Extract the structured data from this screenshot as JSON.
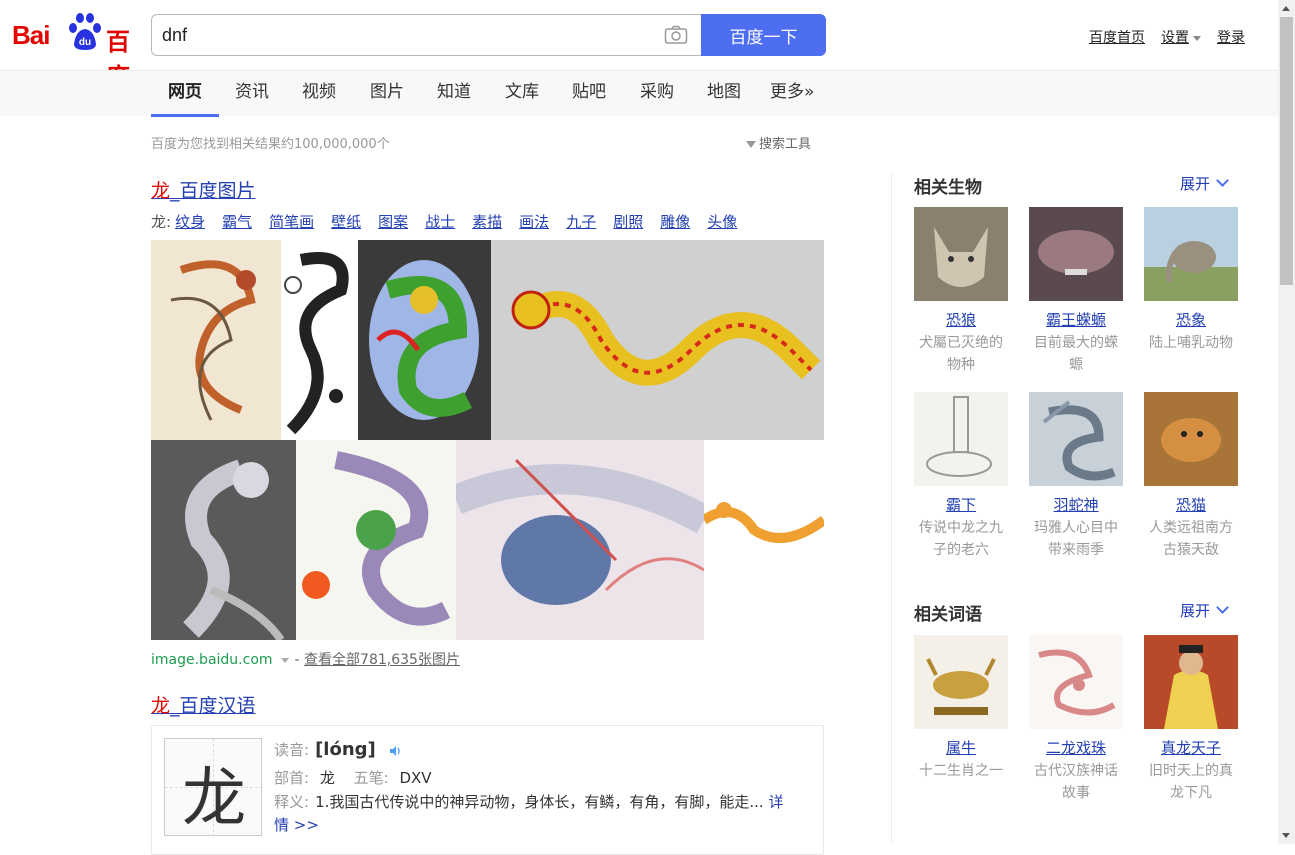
{
  "logo": {
    "bai": "Bai",
    "du": "du",
    "baidu_cn": "百度"
  },
  "search": {
    "value": "dnf",
    "button": "百度一下"
  },
  "top_links": {
    "home": "百度首页",
    "settings": "设置",
    "login": "登录"
  },
  "tabs": [
    "网页",
    "资讯",
    "视频",
    "图片",
    "知道",
    "文库",
    "贴吧",
    "采购",
    "地图",
    "更多»"
  ],
  "active_tab": 0,
  "stats": {
    "text": "百度为您找到相关结果约100,000,000个",
    "tools": "搜索工具"
  },
  "result1": {
    "title_kw": "龙",
    "title_rest": "_百度图片",
    "tag_label": "龙:",
    "tags": [
      "纹身",
      "霸气",
      "简笔画",
      "壁纸",
      "图案",
      "战士",
      "素描",
      "画法",
      "九子",
      "剧照",
      "雕像",
      "头像"
    ],
    "source": "image.baidu.com",
    "more": "查看全部781,635张图片"
  },
  "result2": {
    "title_kw": "龙",
    "title_rest": "_百度汉语",
    "char": "龙",
    "pron_label": "读音:",
    "pron": "[lóng]",
    "radical_label": "部首:",
    "radical": "龙",
    "wubi_label": "五笔:",
    "wubi": "DXV",
    "def_label": "释义:",
    "definition": "1.我国古代传说中的神异动物，身体长，有鳞，有角，有脚，能走...",
    "detail": "详情 >>"
  },
  "side1": {
    "heading": "相关生物",
    "expand": "展开",
    "items": [
      {
        "name": "恐狼",
        "desc": "犬屬已灭绝的物种"
      },
      {
        "name": "霸王蝾螈",
        "desc": "目前最大的蝾螈"
      },
      {
        "name": "恐象",
        "desc": "陆上哺乳动物"
      },
      {
        "name": "霸下",
        "desc": "传说中龙之九子的老六"
      },
      {
        "name": "羽蛇神",
        "desc": "玛雅人心目中带来雨季"
      },
      {
        "name": "恐猫",
        "desc": "人类远祖南方古猿天敌"
      }
    ]
  },
  "side2": {
    "heading": "相关词语",
    "expand": "展开",
    "items": [
      {
        "name": "属牛",
        "desc": "十二生肖之一"
      },
      {
        "name": "二龙戏珠",
        "desc": "古代汉族神话故事"
      },
      {
        "name": "真龙天子",
        "desc": "旧时天上的真龙下凡"
      }
    ]
  },
  "colors": {
    "brand_red": "#e10602",
    "brand_blue": "#4e6ef2",
    "link": "#2440b3",
    "source_green": "#1e9c50"
  }
}
